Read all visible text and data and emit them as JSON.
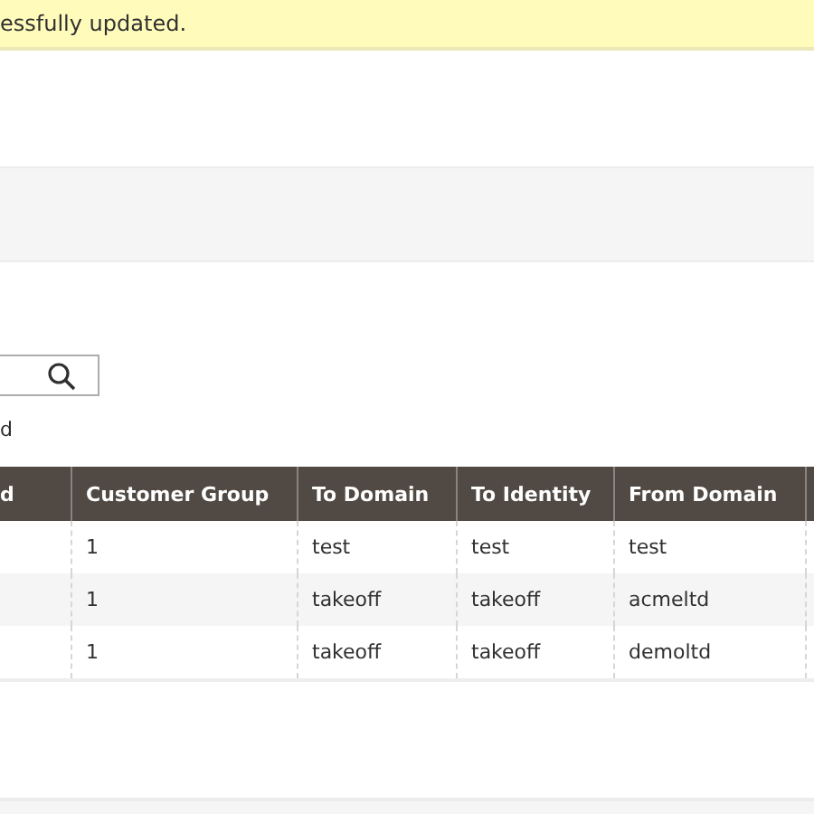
{
  "message": "essfully updated.",
  "records_found": "d",
  "table": {
    "columns": [
      "d",
      "Customer Group",
      "To Domain",
      "To Identity",
      "From Domain"
    ],
    "rows": [
      [
        "",
        "1",
        "test",
        "test",
        "test"
      ],
      [
        "",
        "1",
        "takeoff",
        "takeoff",
        "acmeltd"
      ],
      [
        "",
        "1",
        "takeoff",
        "takeoff",
        "demoltd"
      ]
    ]
  }
}
